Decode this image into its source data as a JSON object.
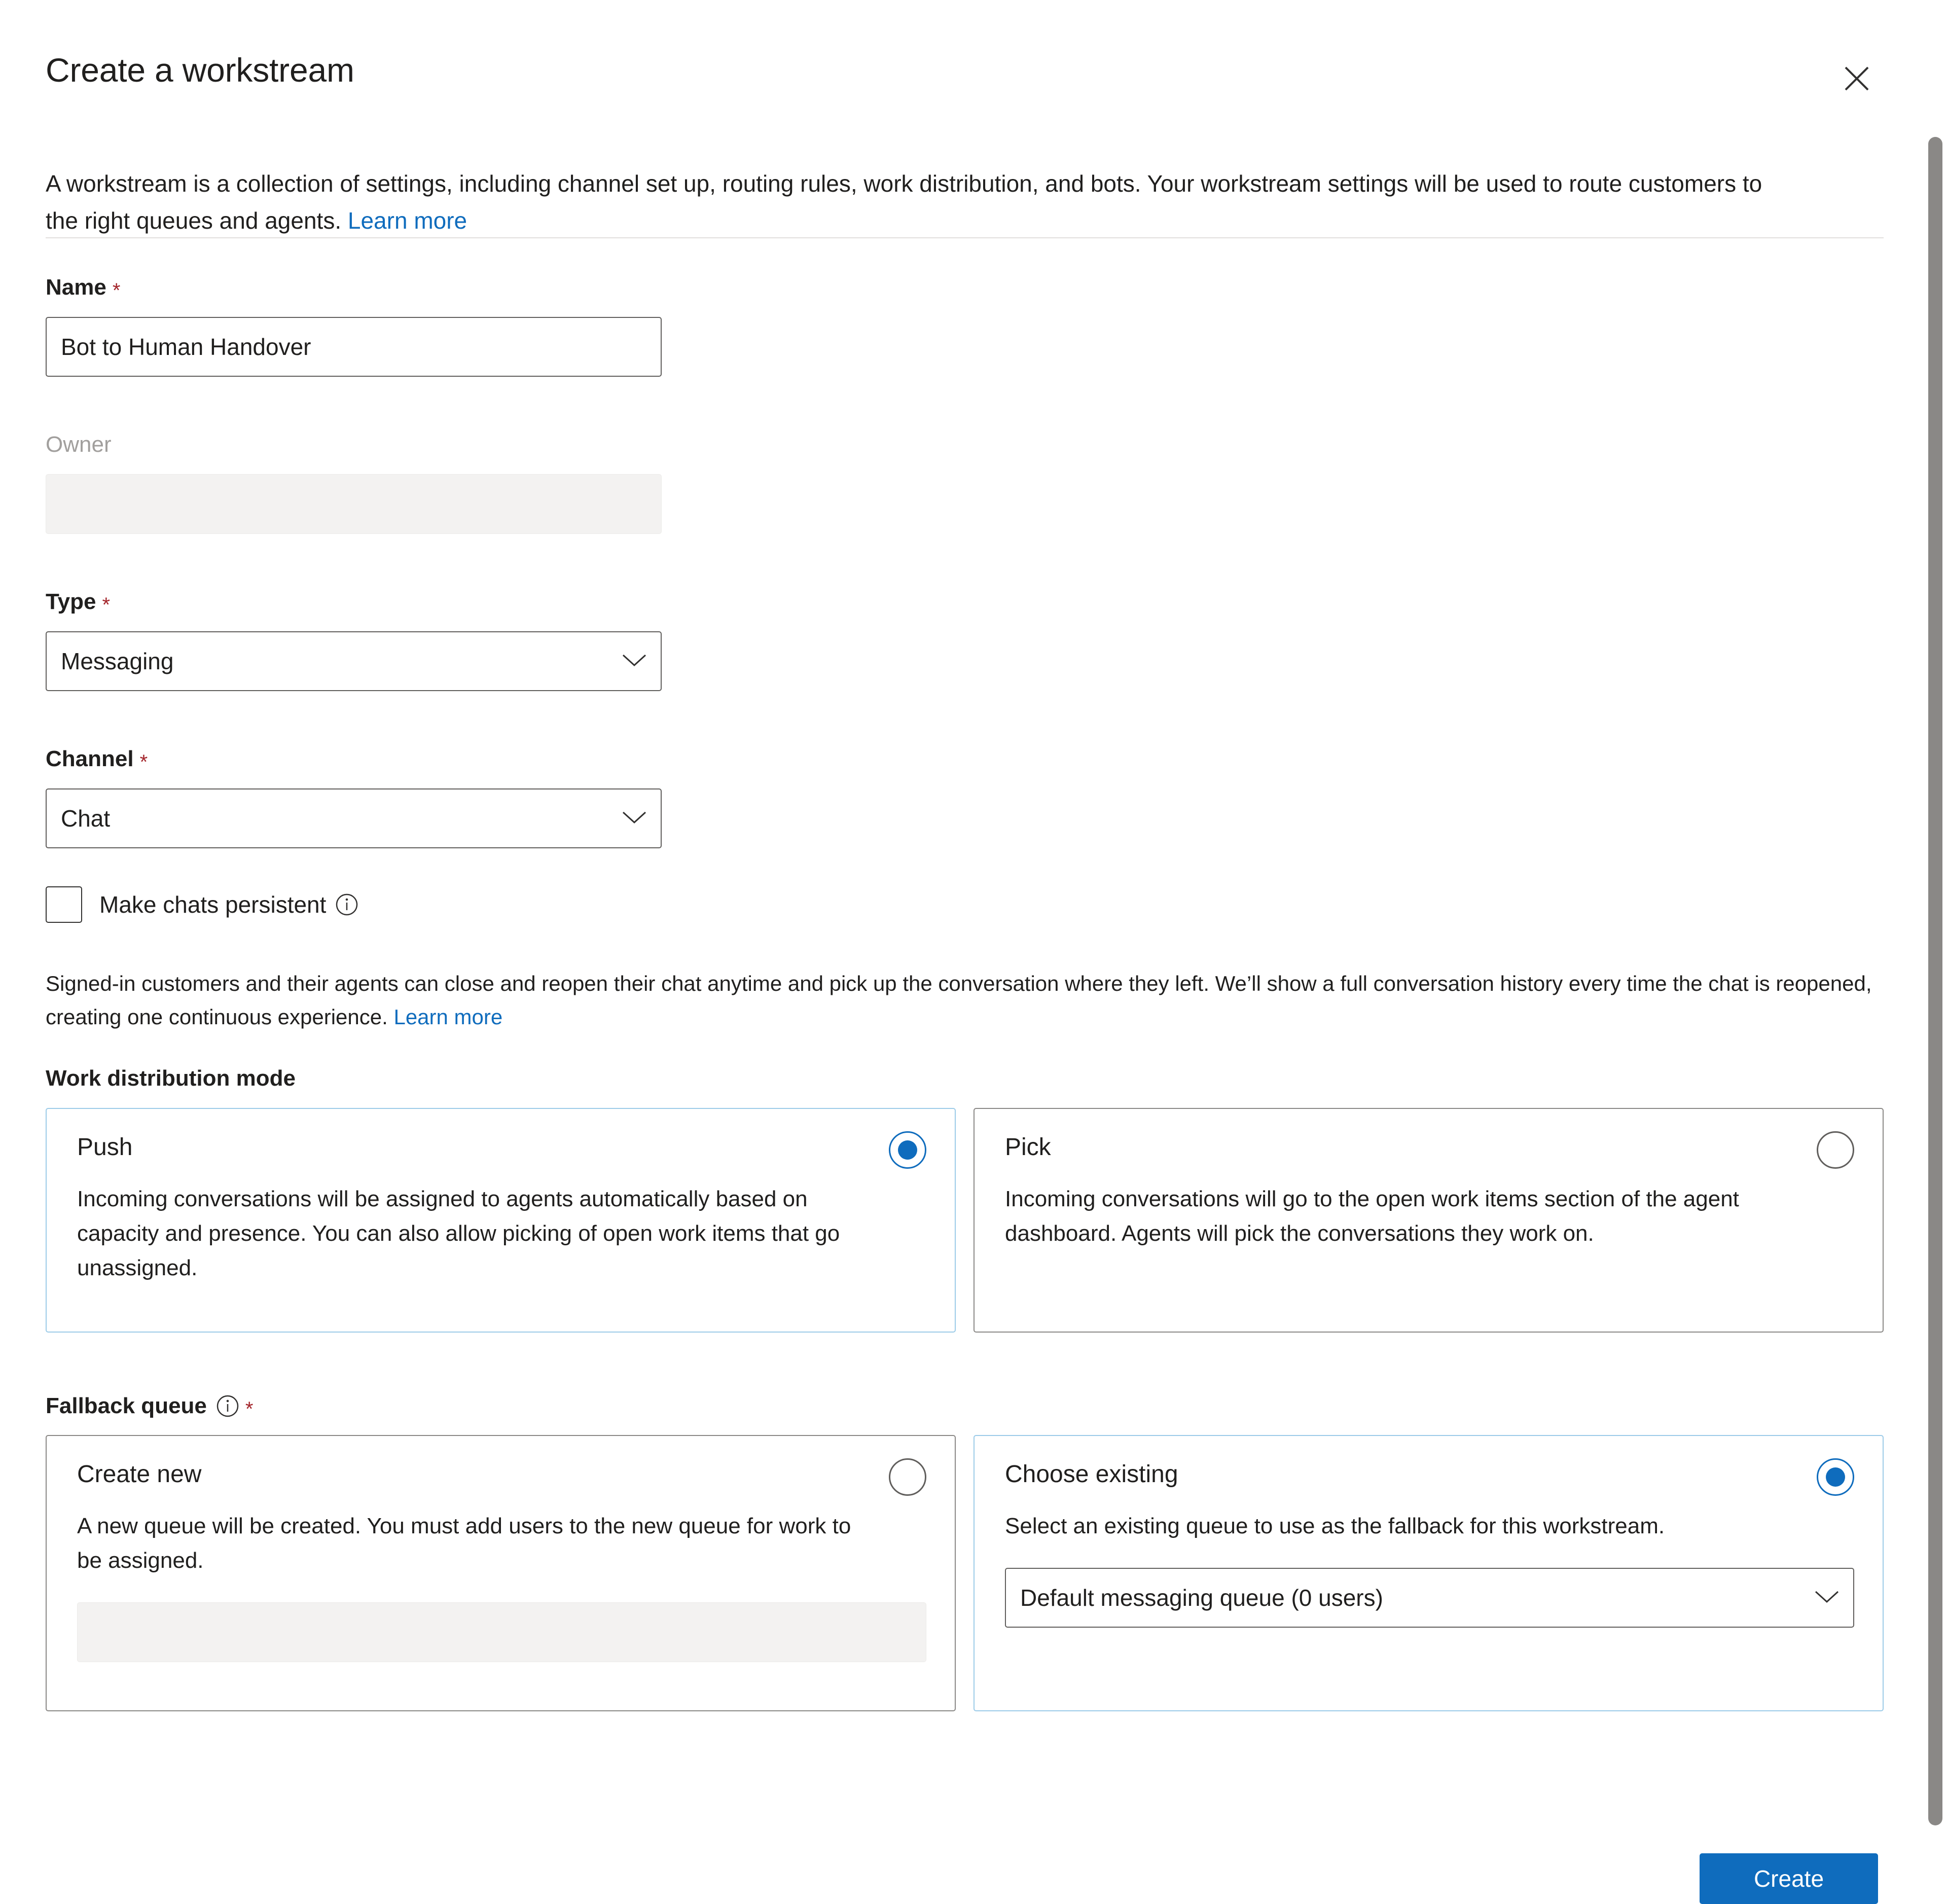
{
  "dialog": {
    "title": "Create a workstream",
    "close_label": "Close",
    "intro_text": "A workstream is a collection of settings, including channel set up, routing rules, work distribution, and bots. Your workstream settings will be used to route customers to the right queues and agents. ",
    "intro_link": "Learn more"
  },
  "fields": {
    "name": {
      "label": "Name",
      "required_mark": "*",
      "value": "Bot to Human Handover",
      "placeholder": ""
    },
    "owner": {
      "label": "Owner",
      "value": "",
      "placeholder": ""
    },
    "type": {
      "label": "Type",
      "required_mark": "*",
      "value": "Messaging"
    },
    "channel": {
      "label": "Channel",
      "required_mark": "*",
      "value": "Chat"
    }
  },
  "persistent_chat": {
    "checkbox_label": "Make chats persistent",
    "checked": false,
    "help_text": "Signed-in customers and their agents can close and reopen their chat anytime and pick up the conversation where they left. We’ll show a full conversation history every time the chat is reopened, creating one continuous experience. ",
    "help_link": "Learn more"
  },
  "work_distribution": {
    "heading": "Work distribution mode",
    "options": [
      {
        "title": "Push",
        "description": "Incoming conversations will be assigned to agents automatically based on capacity and presence. You can also allow picking of open work items that go unassigned.",
        "selected": true
      },
      {
        "title": "Pick",
        "description": "Incoming conversations will go to the open work items section of the agent dashboard. Agents will pick the conversations they work on.",
        "selected": false
      }
    ]
  },
  "fallback_queue": {
    "heading": "Fallback queue",
    "required_mark": "*",
    "options": [
      {
        "title": "Create new",
        "description": "A new queue will be created. You must add users to the new queue for work to be assigned.",
        "selected": false,
        "input_value": ""
      },
      {
        "title": "Choose existing",
        "description": "Select an existing queue to use as the fallback for this workstream.",
        "selected": true,
        "select_value": "Default messaging queue (0 users)"
      }
    ]
  },
  "footer": {
    "primary_button": "Create"
  },
  "colors": {
    "accent": "#0f6cbd",
    "required": "#a4262c",
    "border": "#605e5c",
    "selected_border": "#9ccbe8",
    "disabled_bg": "#f3f2f1",
    "scrollbar": "#8a8886"
  }
}
